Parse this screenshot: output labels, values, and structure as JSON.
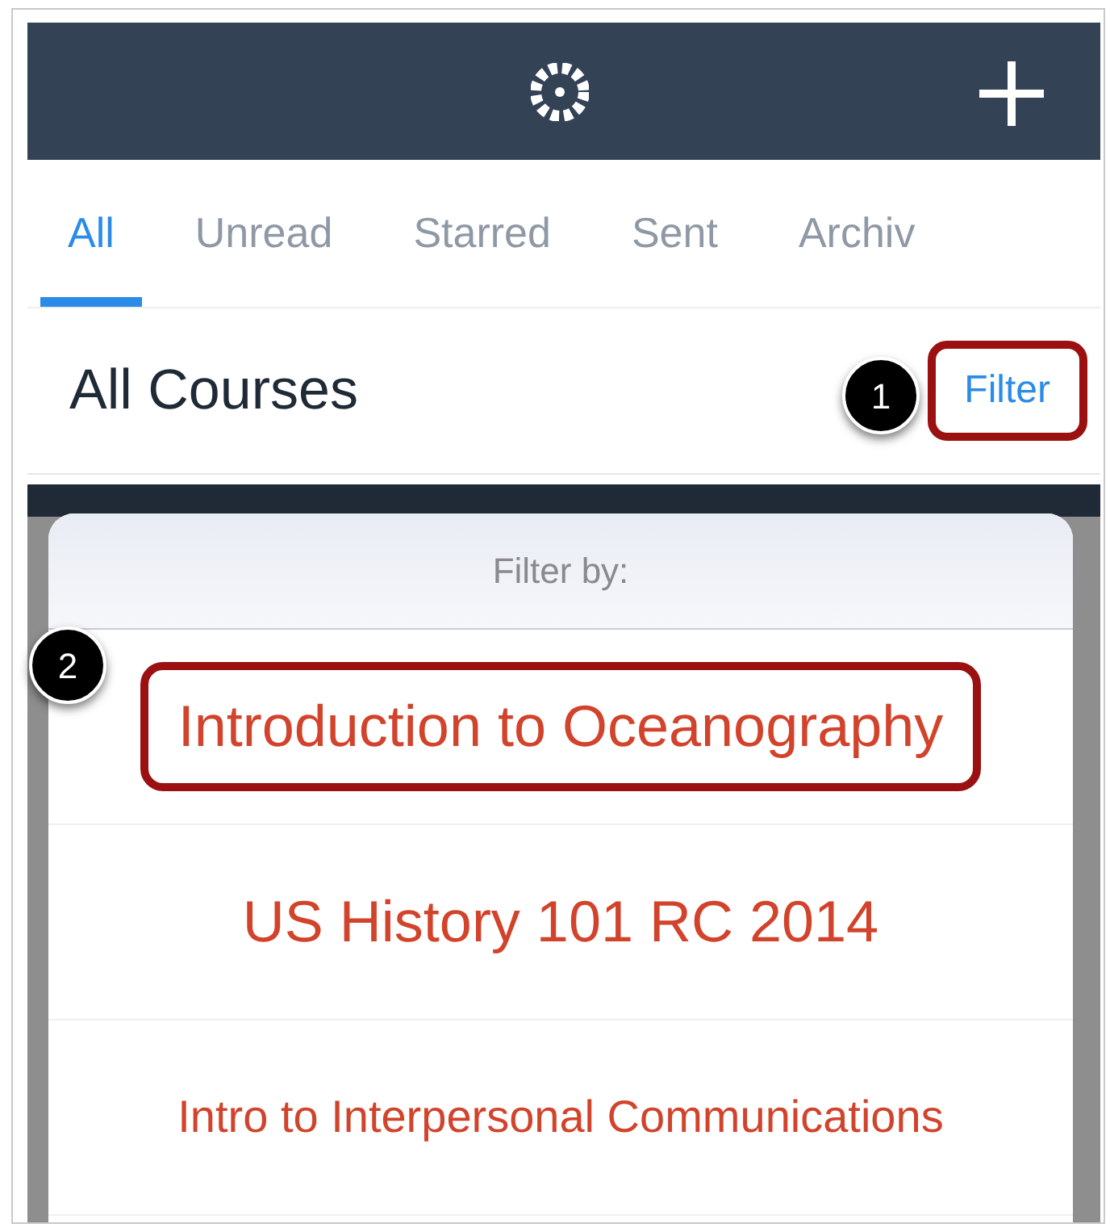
{
  "tabs": [
    {
      "label": "All",
      "selected": true
    },
    {
      "label": "Unread",
      "selected": false
    },
    {
      "label": "Starred",
      "selected": false
    },
    {
      "label": "Sent",
      "selected": false
    },
    {
      "label": "Archiv",
      "selected": false
    }
  ],
  "section": {
    "title": "All Courses",
    "filter_button": {
      "label": "Filter",
      "callout": "1"
    }
  },
  "filter_sheet": {
    "title": "Filter by:",
    "items": [
      {
        "label": "Introduction to Oceanography",
        "kind": "large",
        "callout": "2"
      },
      {
        "label": "US History 101 RC 2014",
        "kind": "large"
      },
      {
        "label": "Intro to Interpersonal Communications",
        "kind": "small"
      }
    ]
  }
}
